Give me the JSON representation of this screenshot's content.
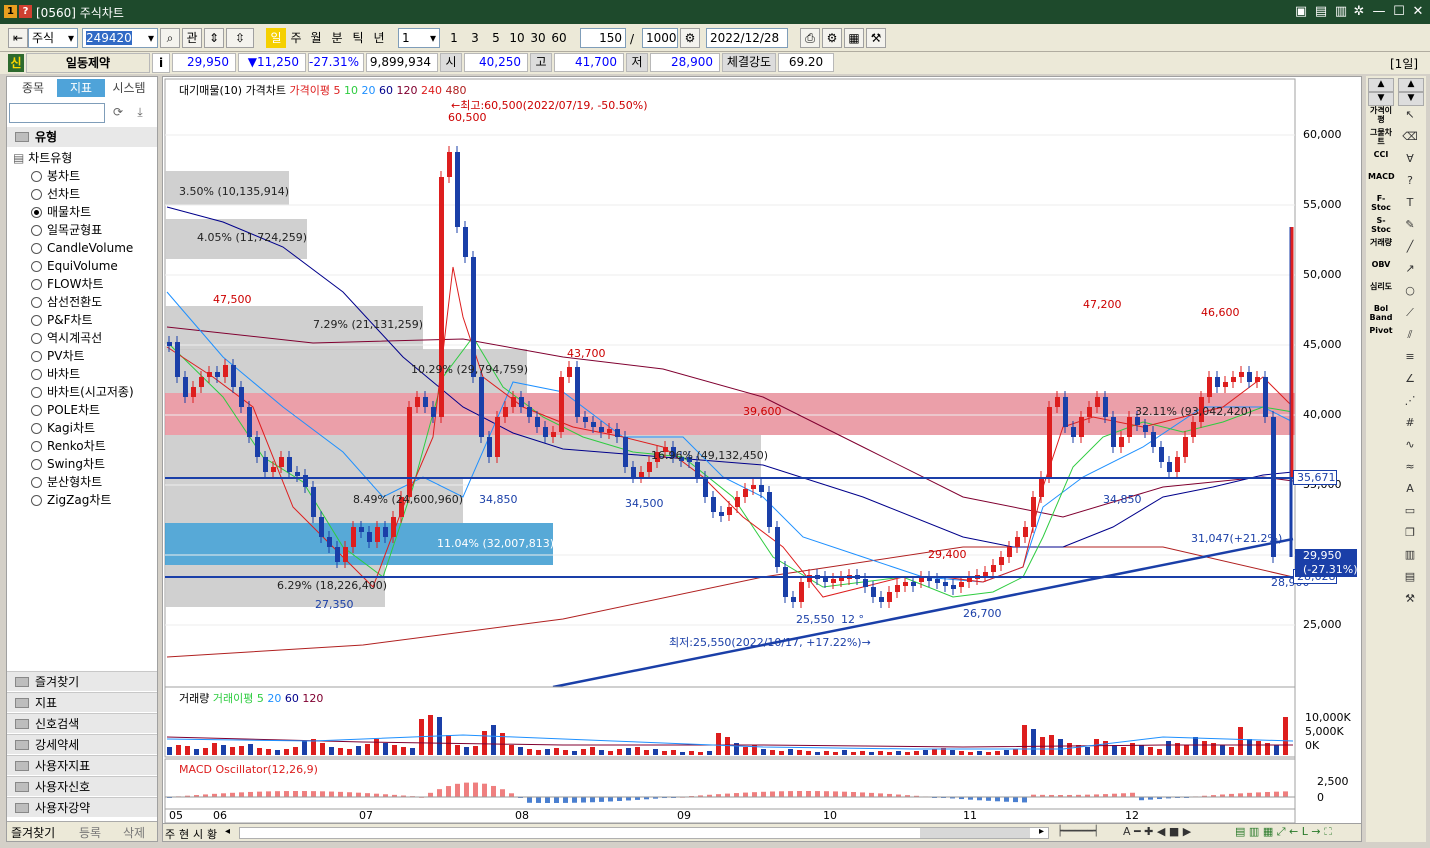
{
  "window": {
    "title": "[0560] 주식차트"
  },
  "toolbar": {
    "market": "주식",
    "code": "249420",
    "gwan": "관",
    "periods": [
      "일",
      "주",
      "월",
      "분",
      "틱",
      "년"
    ],
    "unit": "1",
    "quick": [
      "1",
      "3",
      "5",
      "10",
      "30",
      "60"
    ],
    "count": "150",
    "slash": "/",
    "max": "1000",
    "date": "2022/12/28"
  },
  "quote": {
    "tag": "신",
    "name": "일동제약",
    "info": "i",
    "price": "29,950",
    "change": "▼11,250",
    "pct": "-27.31%",
    "volume": "9,899,934",
    "open_label": "시",
    "open": "40,250",
    "high_label": "고",
    "high": "41,700",
    "low_label": "저",
    "low": "28,900",
    "strength_label": "체결강도",
    "strength": "69.20",
    "period_tag": "[1일]"
  },
  "leftpanel": {
    "tabs": [
      "종목",
      "지표",
      "시스템"
    ],
    "section": "유형",
    "tree_root": "차트유형",
    "items": [
      "봉차트",
      "선차트",
      "매물차트",
      "일목균형표",
      "CandleVolume",
      "EquiVolume",
      "FLOW차트",
      "삼선전환도",
      "P&F차트",
      "역시계곡선",
      "PV차트",
      "바차트",
      "바차트(시고저종)",
      "POLE차트",
      "Kagi차트",
      "Renko차트",
      "Swing차트",
      "분산형차트",
      "ZigZag차트"
    ],
    "selected_index": 2,
    "groups": [
      "즐겨찾기",
      "지표",
      "신호검색",
      "강세약세",
      "사용자지표",
      "사용자신호",
      "사용자강약"
    ],
    "bottom_tabs": [
      "즐겨찾기",
      "등록",
      "삭제"
    ]
  },
  "chart": {
    "legend_main": [
      "대기매물(10)",
      "가격차트",
      "가격이평 5",
      "10",
      "20",
      "60",
      "120",
      "240",
      "480"
    ],
    "legend_volume": [
      "거래량",
      "거래이평 5",
      "20",
      "60",
      "120"
    ],
    "legend_macd": "MACD Oscillator(12,26,9)",
    "y_ticks": [
      "60,000",
      "55,000",
      "50,000",
      "45,000",
      "40,000",
      "35,000",
      "30,000",
      "25,000"
    ],
    "vol_ticks": [
      "10,000K",
      "5,000K",
      "0K"
    ],
    "macd_ticks": [
      "2,500",
      "0"
    ],
    "x_ticks": [
      "05",
      "06",
      "07",
      "08",
      "09",
      "10",
      "11",
      "12"
    ],
    "annotations": {
      "high_note": "←최고:60,500(2022/07/19, -50.50%)",
      "low_note": "최저:25,550(2022/10/17, +17.22%)→",
      "p60500": "60,500",
      "p47500": "47,500",
      "p43700": "43,700",
      "p39600": "39,600",
      "p47200": "47,200",
      "p46600": "46,600",
      "p29400": "29,400",
      "p34850a": "34,850",
      "p34500": "34,500",
      "p27350": "27,350",
      "p26700": "26,700",
      "p34850b": "34,850",
      "p28900": "28,900",
      "p25550": "25,550",
      "trend": "31,047(+21.2%)",
      "cross": "12 °",
      "price_tag": "29,950",
      "price_tag2": "(-27.31%)",
      "hline1": "35,671",
      "hline2": "28,628"
    },
    "supply_bars": [
      {
        "label": "3.50% (10,135,914)"
      },
      {
        "label": "4.05% (11,724,259)"
      },
      {
        "label": "7.29% (21,131,259)"
      },
      {
        "label": "10.29% (29,794,759)"
      },
      {
        "label": "32.11% (93,042,420)"
      },
      {
        "label": "16.96% (49,132,450)"
      },
      {
        "label": "8.49% (24,600,960)"
      },
      {
        "label": "11.04% (32,007,813)"
      },
      {
        "label": "6.29% (18,226,400)"
      }
    ]
  },
  "statusbar": {
    "tabs": [
      "주",
      "현",
      "시",
      "황"
    ]
  },
  "rightbar": {
    "indicators": [
      "가격이평",
      "그물차트",
      "CCI",
      "MACD",
      "F-Stoc",
      "S-Stoc",
      "거래량",
      "OBV",
      "심리도",
      "Bol Band",
      "Pivot"
    ]
  }
}
